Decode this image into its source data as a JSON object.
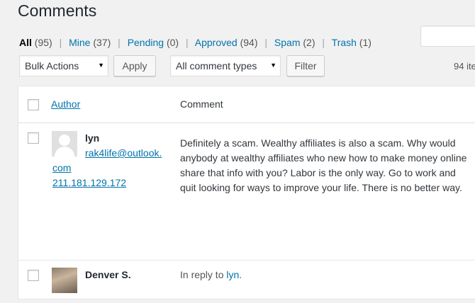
{
  "page": {
    "title": "Comments"
  },
  "filters": [
    {
      "label": "All",
      "count": "(95)"
    },
    {
      "label": "Mine",
      "count": "(37)"
    },
    {
      "label": "Pending",
      "count": "(0)"
    },
    {
      "label": "Approved",
      "count": "(94)"
    },
    {
      "label": "Spam",
      "count": "(2)"
    },
    {
      "label": "Trash",
      "count": "(1)"
    }
  ],
  "separator": "|",
  "toolbar": {
    "bulk_actions": "Bulk Actions",
    "apply": "Apply",
    "comment_types": "All comment types",
    "filter": "Filter",
    "items_count": "94 ite"
  },
  "table": {
    "columns": {
      "author": "Author",
      "comment": "Comment"
    }
  },
  "comments": [
    {
      "author_name": "lyn",
      "email_line1": "rak4life@outlook.",
      "email_line2": "com",
      "ip": "211.181.129.172",
      "text": "Definitely a scam. Wealthy affiliates is also a scam. Why would anybody at wealthy affiliates who new how to make money online share that info with you? Labor is the only way. Go to work and quit looking for ways to improve your life. There is no better way."
    },
    {
      "author_name": "Denver S.",
      "reply_prefix": "In reply to",
      "reply_to": "lyn",
      "reply_suffix": "."
    }
  ]
}
